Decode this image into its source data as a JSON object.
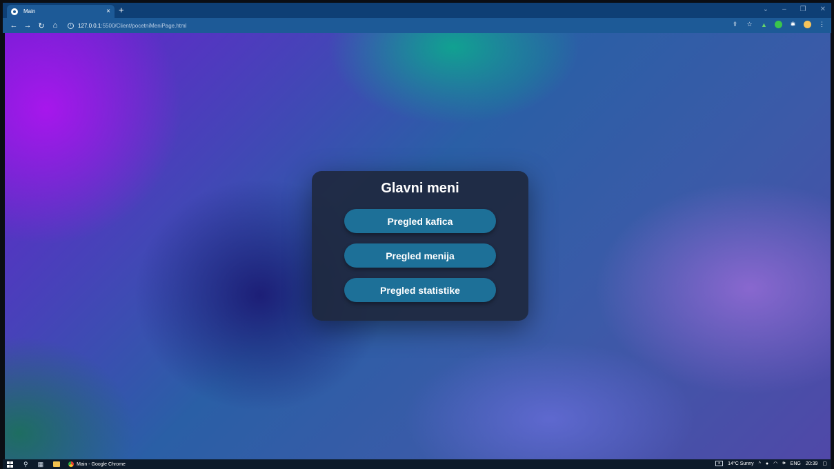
{
  "browser": {
    "tab_title": "Main",
    "tab_close": "×",
    "new_tab": "+",
    "window_controls": {
      "minimize": "–",
      "restore": "❐",
      "close": "✕",
      "chevron": "⌄"
    },
    "url_host": "127.0.0.1",
    "url_path": ":5500/Client/pocetniMeniPage.html"
  },
  "menu": {
    "title": "Glavni meni",
    "buttons": [
      {
        "label": "Pregled kafica"
      },
      {
        "label": "Pregled menija"
      },
      {
        "label": "Pregled statistike"
      }
    ]
  },
  "taskbar": {
    "app_label": "Main - Google Chrome",
    "weather": "14°C  Sunny",
    "language": "ENG",
    "time": "20:39"
  },
  "colors": {
    "button_bg": "#1d7098",
    "card_bg": "#1e283e",
    "tab_active": "#1d5a97"
  }
}
